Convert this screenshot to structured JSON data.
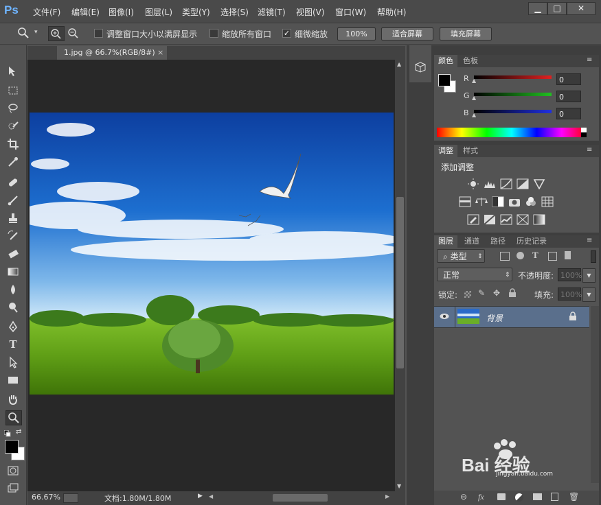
{
  "app": {
    "logo": "Ps"
  },
  "menu": [
    "文件(F)",
    "编辑(E)",
    "图像(I)",
    "图层(L)",
    "类型(Y)",
    "选择(S)",
    "滤镜(T)",
    "视图(V)",
    "窗口(W)",
    "帮助(H)"
  ],
  "window_controls": {
    "minimize": "▁",
    "maximize": "□",
    "close": "✕"
  },
  "options": {
    "resize_windows_label": "调整窗口大小以满屏显示",
    "resize_windows_checked": false,
    "zoom_all_label": "缩放所有窗口",
    "zoom_all_checked": false,
    "scrubby_label": "细微缩放",
    "scrubby_checked": true,
    "btn_100": "100%",
    "btn_fit": "适合屏幕",
    "btn_fill": "填充屏幕"
  },
  "document": {
    "tab_title": "1.jpg @ 66.7%(RGB/8#)",
    "tab_close": "×"
  },
  "status": {
    "zoom": "66.67%",
    "doc_info": "文档:1.80M/1.80M"
  },
  "color_panel": {
    "tabs": [
      "颜色",
      "色板"
    ],
    "channels": [
      {
        "label": "R",
        "value": "0",
        "color": "#e02020"
      },
      {
        "label": "G",
        "value": "0",
        "color": "#20c020"
      },
      {
        "label": "B",
        "value": "0",
        "color": "#2030e0"
      }
    ]
  },
  "adjust_panel": {
    "tabs": [
      "调整",
      "样式"
    ],
    "title": "添加调整"
  },
  "layers_panel": {
    "tabs": [
      "图层",
      "通道",
      "路径",
      "历史记录"
    ],
    "filter_label": "类型",
    "blend_mode": "正常",
    "opacity_label": "不透明度:",
    "opacity_value": "100%",
    "lock_label": "锁定:",
    "fill_label": "填充:",
    "fill_value": "100%",
    "layer_name": "背景"
  },
  "watermark": {
    "text": "Bai 经验",
    "sub": "jingyan.baidu.com"
  },
  "colors": {
    "accent": "#6fb4ff",
    "panel": "#535353",
    "canvas": "#282828"
  }
}
